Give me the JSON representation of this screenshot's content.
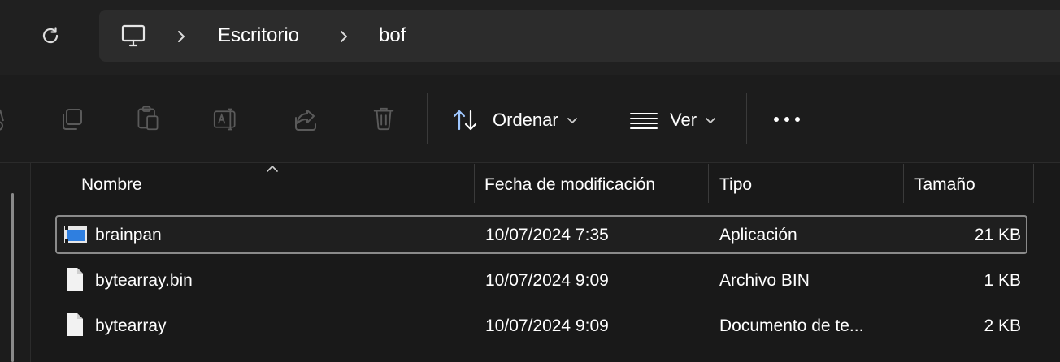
{
  "address": {
    "crumbs": [
      "Escritorio",
      "bof"
    ]
  },
  "toolbar": {
    "sort_label": "Ordenar",
    "view_label": "Ver"
  },
  "columns": {
    "name": "Nombre",
    "date": "Fecha de modificación",
    "type": "Tipo",
    "size": "Tamaño"
  },
  "files": [
    {
      "name": "brainpan",
      "date": "10/07/2024 7:35",
      "type": "Aplicación",
      "size": "21 KB",
      "icon": "application-icon",
      "selected": true
    },
    {
      "name": "bytearray.bin",
      "date": "10/07/2024 9:09",
      "type": "Archivo BIN",
      "size": "1 KB",
      "icon": "file-icon",
      "selected": false
    },
    {
      "name": "bytearray",
      "date": "10/07/2024 9:09",
      "type": "Documento de te...",
      "size": "2 KB",
      "icon": "file-icon",
      "selected": false
    }
  ]
}
